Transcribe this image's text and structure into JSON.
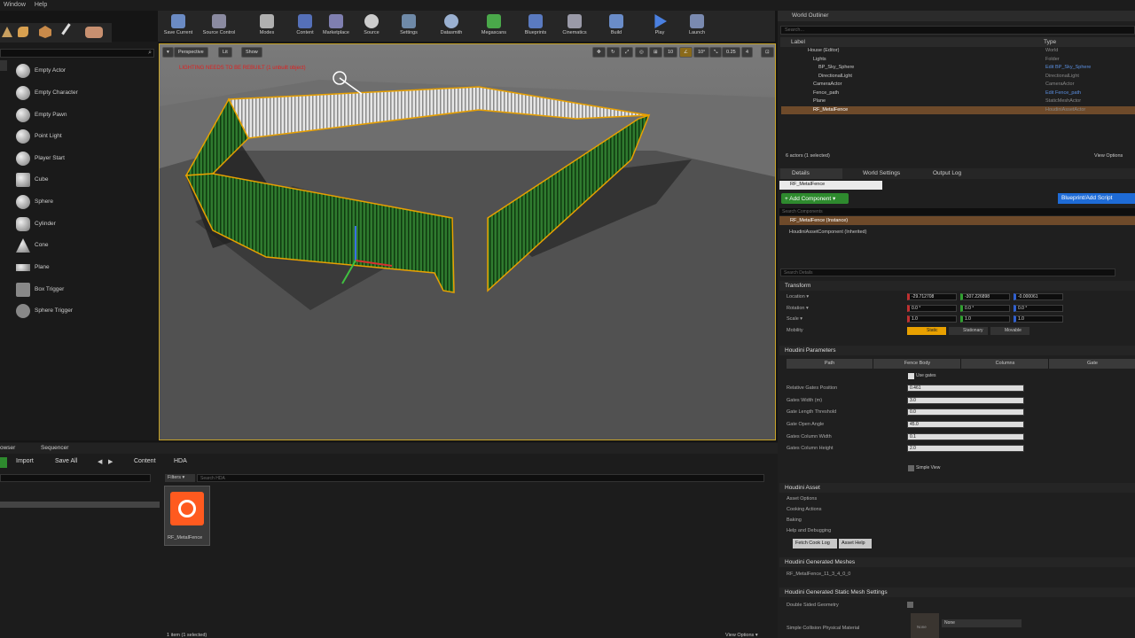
{
  "menu": [
    "Window",
    "Help"
  ],
  "toolbar": [
    {
      "label": "Save Current",
      "icon": "save-icon"
    },
    {
      "label": "Source Control",
      "icon": "source-control-icon"
    },
    {
      "label": "Modes",
      "icon": "modes-icon"
    },
    {
      "label": "Content",
      "icon": "content-icon"
    },
    {
      "label": "Marketplace",
      "icon": "marketplace-icon"
    },
    {
      "label": "Source",
      "icon": "source-icon"
    },
    {
      "label": "Settings",
      "icon": "settings-icon"
    },
    {
      "label": "Datasmith",
      "icon": "datasmith-icon"
    },
    {
      "label": "Megascans",
      "icon": "megascans-icon"
    },
    {
      "label": "Blueprints",
      "icon": "blueprints-icon"
    },
    {
      "label": "Cinematics",
      "icon": "cinematics-icon"
    },
    {
      "label": "Build",
      "icon": "build-icon"
    },
    {
      "label": "Play",
      "icon": "play-icon"
    },
    {
      "label": "Launch",
      "icon": "launch-icon"
    }
  ],
  "place_items": [
    "Empty Actor",
    "Empty Character",
    "Empty Pawn",
    "Point Light",
    "Player Start",
    "Cube",
    "Sphere",
    "Cylinder",
    "Cone",
    "Plane",
    "Box Trigger",
    "Sphere Trigger"
  ],
  "viewport": {
    "perspective": "Perspective",
    "lit": "Lit",
    "show": "Show",
    "warning": "LIGHTING NEEDS TO BE REBUILT (1 unbuilt object)",
    "snap_grid": "10",
    "snap_rot": "10°",
    "snap_scale": "0.25",
    "cam_speed": "4"
  },
  "outliner": {
    "title": "World Outliner",
    "search_placeholder": "Search...",
    "col_label": "Label",
    "col_type": "Type",
    "rows": [
      {
        "name": "House (Editor)",
        "type": "World"
      },
      {
        "name": "Lights",
        "type": "Folder"
      },
      {
        "name": "BP_Sky_Sphere",
        "type": "Edit BP_Sky_Sphere"
      },
      {
        "name": "DirectionalLight",
        "type": "DirectionalLight"
      },
      {
        "name": "CameraActor",
        "type": "CameraActor"
      },
      {
        "name": "Fence_path",
        "type": "Edit Fence_path"
      },
      {
        "name": "Plane",
        "type": "StaticMeshActor"
      },
      {
        "name": "RF_MetalFence",
        "type": "HoudiniAssetActor"
      }
    ],
    "status": "6 actors (1 selected)",
    "view_options": "View Options"
  },
  "details": {
    "tabs": [
      "Details",
      "World Settings",
      "Output Log"
    ],
    "name": "RF_MetalFence",
    "add_component": "+ Add Component ▾",
    "blueprint_btn": "Blueprint/Add Script",
    "search_components": "Search Components",
    "instance": "RF_MetalFence (Instance)",
    "component": "HoudiniAssetComponent (Inherited)",
    "search_details": "Search Details",
    "transform": "Transform",
    "location_label": "Location ▾",
    "rotation_label": "Rotation ▾",
    "scale_label": "Scale ▾",
    "mobility_label": "Mobility",
    "location": [
      "-29.712708",
      "-307.226898",
      "-0.000061"
    ],
    "rotation": [
      "0.0 °",
      "0.0 °",
      "0.0 °"
    ],
    "scale": [
      "1.0",
      "1.0",
      "1.0"
    ],
    "mobility": [
      "Static",
      "Stationary",
      "Movable"
    ]
  },
  "houdini": {
    "title": "Houdini Parameters",
    "tabs": [
      "Path",
      "Fence Body",
      "Columns",
      "Gate"
    ],
    "use_gates": "Use gates",
    "params": [
      {
        "label": "Relative Gates Position",
        "value": "0.461"
      },
      {
        "label": "Gates Width (m)",
        "value": "3.0"
      },
      {
        "label": "Gate Length Threshold",
        "value": "0.0"
      },
      {
        "label": "Gate Open Angle",
        "value": "45.0"
      },
      {
        "label": "Gates Column Width",
        "value": "0.1"
      },
      {
        "label": "Gates Column Height",
        "value": "2.0"
      }
    ],
    "simple_view": "Simple View",
    "asset_title": "Houdini Asset",
    "asset_items": [
      "Asset Options",
      "Cooking Actions",
      "Baking",
      "Help and Debugging"
    ],
    "fetch_log": "Fetch Cook Log",
    "asset_help": "Asset Help",
    "meshes_title": "Houdini Generated Meshes",
    "mesh_name": "RF_MetalFence_11_3_4_0_0",
    "settings_title": "Houdini Generated Static Mesh Settings",
    "double_sided": "Double Sided Geometry",
    "collision_mat": "Simple Collision Physical Material",
    "none": "None"
  },
  "content": {
    "tabs": [
      "owser",
      "Sequencer"
    ],
    "import": "Import",
    "save_all": "Save All",
    "path": [
      "Content",
      "HDA"
    ],
    "filters": "Filters ▾",
    "search_placeholder": "Search HDA",
    "asset_name": "RF_MetalFence",
    "status": "1 item (1 selected)",
    "view_options": "View Options ▾"
  },
  "colors": {
    "accent": "#e8a000",
    "selection": "#c8a428",
    "houdini": "#ff5a1f",
    "green": "#2b7a2b",
    "blue": "#1e6bd6"
  }
}
